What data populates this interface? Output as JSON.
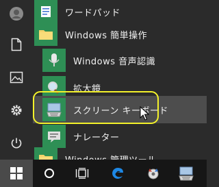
{
  "start_menu": {
    "items": [
      {
        "label": "ワードパッド",
        "icon": "wordpad-icon"
      },
      {
        "label": "Windows 簡単操作",
        "icon": "folder-icon"
      },
      {
        "label": "Windows 音声認識",
        "icon": "microphone-icon"
      },
      {
        "label": "拡大鏡",
        "icon": "magnifier-icon"
      },
      {
        "label": "スクリーン キーボード",
        "icon": "on-screen-keyboard-icon"
      },
      {
        "label": "ナレーター",
        "icon": "narrator-icon"
      },
      {
        "label": "Windows 管理ツール",
        "icon": "folder-icon"
      }
    ],
    "selected": "スクリーン キーボード"
  },
  "left_rail": [
    "user-avatar",
    "documents-icon",
    "pictures-icon",
    "settings-gear-icon",
    "power-icon"
  ],
  "taskbar": [
    "windows-start-icon",
    "cortana-search-icon",
    "task-view-icon",
    "edge-icon",
    "media-player-icon",
    "keyboard-app-icon"
  ],
  "colors": {
    "tile_green": "#2e8f55",
    "highlight_ring": "#f4f22a",
    "background": "#2b2b2b"
  }
}
